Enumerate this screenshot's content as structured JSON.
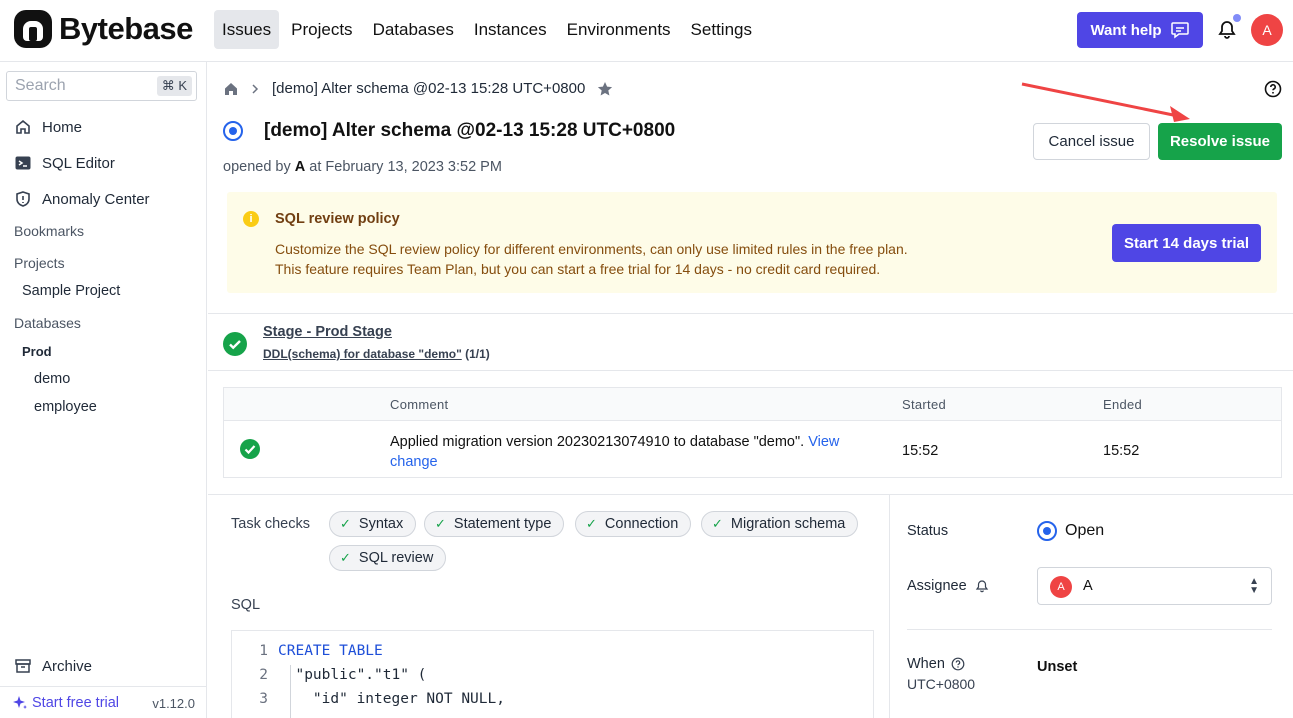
{
  "app": {
    "name": "Bytebase"
  },
  "nav": [
    "Issues",
    "Projects",
    "Databases",
    "Instances",
    "Environments",
    "Settings"
  ],
  "header": {
    "help_label": "Want help",
    "avatar_initial": "A"
  },
  "sidebar": {
    "search_placeholder": "Search",
    "search_shortcut": "⌘ K",
    "items": [
      {
        "label": "Home",
        "icon": "home-icon"
      },
      {
        "label": "SQL Editor",
        "icon": "terminal-icon"
      },
      {
        "label": "Anomaly Center",
        "icon": "shield-icon"
      }
    ],
    "bookmarks_label": "Bookmarks",
    "projects_label": "Projects",
    "projects": [
      "Sample Project"
    ],
    "databases_label": "Databases",
    "env": "Prod",
    "databases": [
      "demo",
      "employee"
    ],
    "archive_label": "Archive",
    "trial_label": "Start free trial",
    "version": "v1.12.0"
  },
  "issue": {
    "breadcrumb": "[demo] Alter schema @02-13 15:28 UTC+0800",
    "title": "[demo] Alter schema @02-13 15:28 UTC+0800",
    "opened_prefix": "opened by",
    "opened_by": "A",
    "opened_at": "at February 13, 2023 3:52 PM",
    "cancel_label": "Cancel issue",
    "resolve_label": "Resolve issue"
  },
  "banner": {
    "title": "SQL review policy",
    "line1": "Customize the SQL review policy for different environments, can only use limited rules in the free plan.",
    "line2": "This feature requires Team Plan, but you can start a free trial for 14 days - no credit card required.",
    "button": "Start 14 days trial"
  },
  "stage": {
    "title": "Stage - Prod Stage",
    "task_link": "DDL(schema) for database \"demo\"",
    "task_count": "(1/1)"
  },
  "task_table": {
    "headers": [
      "Comment",
      "Started",
      "Ended"
    ],
    "row": {
      "comment": "Applied migration version 20230213074910 to database \"demo\".",
      "link_1": "View",
      "link_2": "change",
      "started": "15:52",
      "ended": "15:52"
    }
  },
  "task_checks": {
    "label": "Task checks",
    "chips": [
      "Syntax",
      "Statement type",
      "Connection",
      "Migration schema",
      "SQL review"
    ]
  },
  "sql": {
    "label": "SQL",
    "lines": [
      {
        "n": "1",
        "text": "CREATE TABLE"
      },
      {
        "n": "2",
        "text": "\"public\".\"t1\" ("
      },
      {
        "n": "3",
        "text": "\"id\" integer NOT NULL,"
      }
    ]
  },
  "properties": {
    "status_label": "Status",
    "status_value": "Open",
    "assignee_label": "Assignee",
    "assignee_initial": "A",
    "assignee_name": "A",
    "when_label": "When",
    "when_tz": "UTC+0800",
    "when_value": "Unset"
  },
  "colors": {
    "primary": "#4f46e5",
    "success": "#16a34a",
    "open": "#2563eb",
    "banner_bg": "#fefce8"
  }
}
